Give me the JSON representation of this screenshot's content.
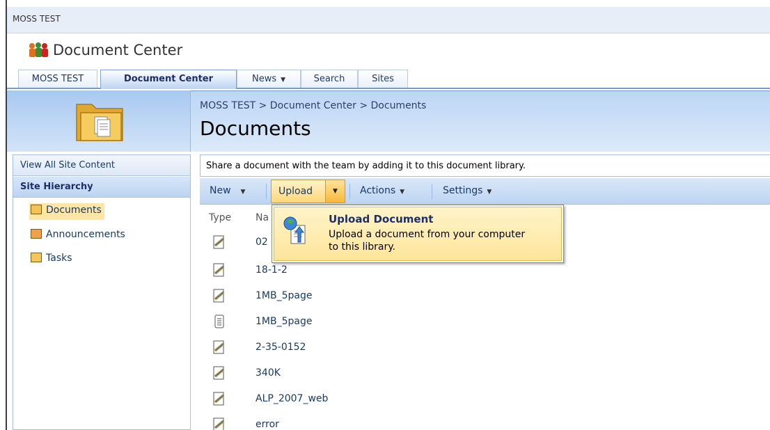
{
  "header": {
    "top_site": "MOSS TEST",
    "site_title": "Document Center"
  },
  "tabs": [
    {
      "label": "MOSS TEST"
    },
    {
      "label": "Document Center"
    },
    {
      "label": "News"
    },
    {
      "label": "Search"
    },
    {
      "label": "Sites"
    }
  ],
  "breadcrumb": "MOSS TEST > Document Center > Documents",
  "page_title": "Documents",
  "leftnav": {
    "view_all": "View All Site Content",
    "hierarchy": "Site Hierarchy",
    "items": [
      {
        "label": "Documents"
      },
      {
        "label": "Announcements"
      },
      {
        "label": "Tasks"
      }
    ]
  },
  "description": "Share a document with the team by adding it to this document library.",
  "toolbar": {
    "new": "New",
    "upload": "Upload",
    "actions": "Actions",
    "settings": "Settings"
  },
  "list": {
    "col_type": "Type",
    "col_name": "Na",
    "rows": [
      {
        "name": "02"
      },
      {
        "name": "18-1-2"
      },
      {
        "name": "1MB_5page"
      },
      {
        "name": "1MB_5page"
      },
      {
        "name": "2-35-0152"
      },
      {
        "name": "340K"
      },
      {
        "name": "ALP_2007_web"
      },
      {
        "name": "error"
      }
    ]
  },
  "upload_menu": {
    "title": "Upload Document",
    "description": "Upload a document from your computer to this library."
  },
  "colors": {
    "accent": "#173a6b",
    "toolbar": "#bcd4f2",
    "highlight": "#ffd779"
  }
}
